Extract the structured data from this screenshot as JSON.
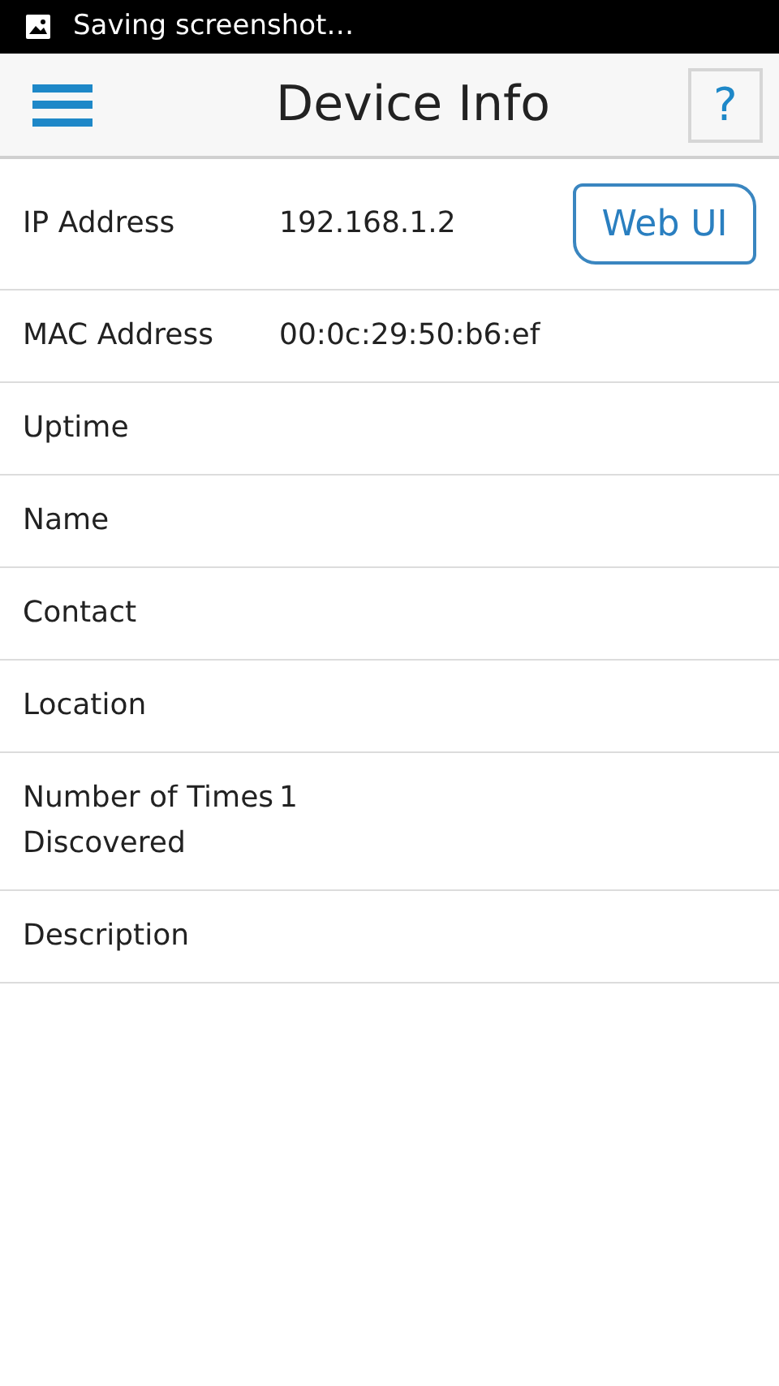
{
  "status_bar": {
    "notification": "Saving screenshot…"
  },
  "header": {
    "title": "Device Info",
    "help_button": "?"
  },
  "rows": [
    {
      "label": "IP Address",
      "value": "192.168.1.2",
      "button": "Web UI"
    },
    {
      "label": "MAC Address",
      "value": "00:0c:29:50:b6:ef"
    },
    {
      "label": "Uptime"
    },
    {
      "label": "Name"
    },
    {
      "label": "Contact"
    },
    {
      "label": "Location"
    },
    {
      "label": "Number of Times Discovered",
      "value": "1"
    },
    {
      "label": "Description"
    }
  ]
}
